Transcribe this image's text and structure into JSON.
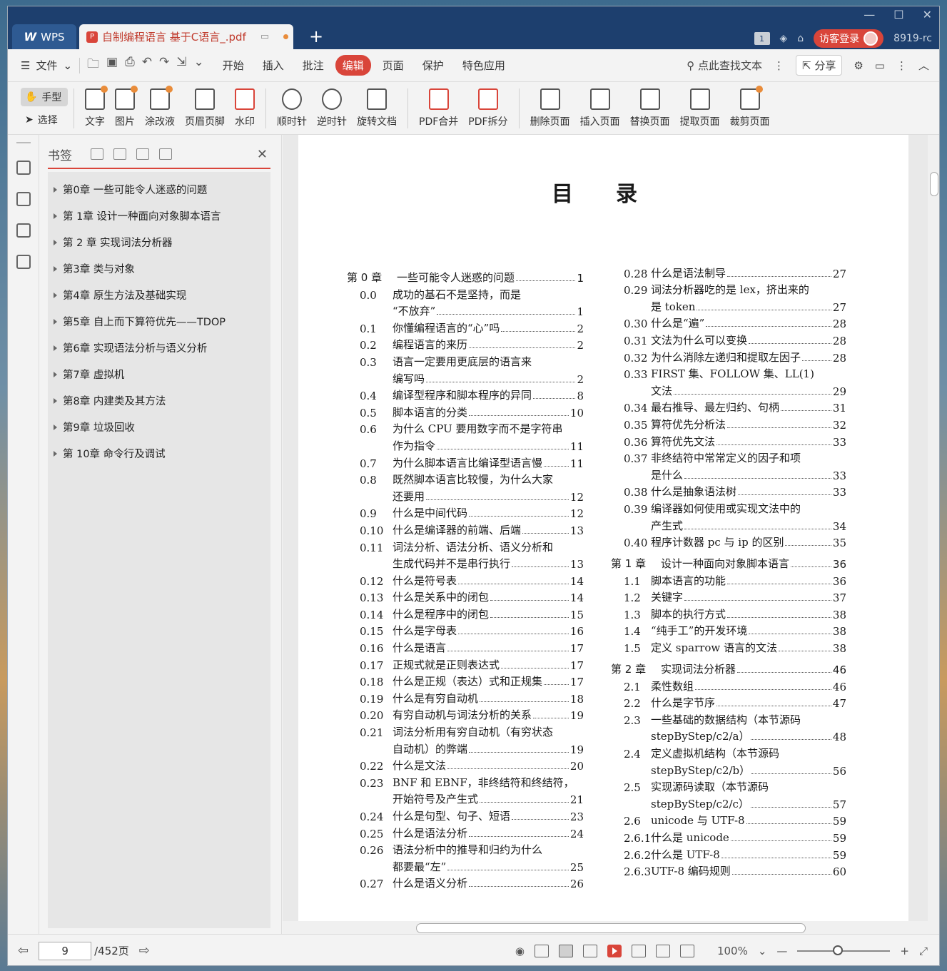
{
  "titlebar": {
    "app_tab": "WPS",
    "doc_tab": "自制编程语言 基于C语言_.pdf",
    "page_badge": "1",
    "login": "访客登录",
    "user_id": "8919-rc"
  },
  "menubar": {
    "file": "文件",
    "items": [
      "开始",
      "插入",
      "批注",
      "编辑",
      "页面",
      "保护",
      "特色应用"
    ],
    "active": "编辑",
    "search": "点此查找文本",
    "share": "分享"
  },
  "ribbon": {
    "hand": "手型",
    "select": "选择",
    "buttons": [
      "文字",
      "图片",
      "涂改液",
      "页眉页脚",
      "水印",
      "顺时针",
      "逆时针",
      "旋转文档",
      "PDF合并",
      "PDF拆分",
      "删除页面",
      "插入页面",
      "替换页面",
      "提取页面",
      "裁剪页面"
    ]
  },
  "bookmarks": {
    "title": "书签",
    "items": [
      "第0章 一些可能令人迷惑的问题",
      "第 1章 设计一种面向对象脚本语言",
      "第 2 章 实现词法分析器",
      "第3章 类与对象",
      "第4章 原生方法及基础实现",
      "第5章 自上而下算符优先——TDOP",
      "第6章 实现语法分析与语义分析",
      "第7章 虚拟机",
      "第8章 内建类及其方法",
      "第9章 垃圾回收",
      "第 10章 命令行及调试"
    ]
  },
  "page": {
    "title": "目录",
    "left": [
      {
        "n": "第 0 章",
        "t": "一些可能令人迷惑的问题",
        "p": "1",
        "ch": true
      },
      {
        "n": "0.0",
        "t": "成功的基石不是坚持，而是",
        "p": ""
      },
      {
        "n": "",
        "t": "“不放弃”",
        "p": "1"
      },
      {
        "n": "0.1",
        "t": "你懂编程语言的“心”吗",
        "p": "2"
      },
      {
        "n": "0.2",
        "t": "编程语言的来历",
        "p": "2"
      },
      {
        "n": "0.3",
        "t": "语言一定要用更底层的语言来",
        "p": ""
      },
      {
        "n": "",
        "t": "编写吗",
        "p": "2"
      },
      {
        "n": "0.4",
        "t": "编译型程序和脚本程序的异同",
        "p": "8"
      },
      {
        "n": "0.5",
        "t": "脚本语言的分类",
        "p": "10"
      },
      {
        "n": "0.6",
        "t": "为什么 CPU 要用数字而不是字符串",
        "p": ""
      },
      {
        "n": "",
        "t": "作为指令",
        "p": "11"
      },
      {
        "n": "0.7",
        "t": "为什么脚本语言比编译型语言慢",
        "p": "11"
      },
      {
        "n": "0.8",
        "t": "既然脚本语言比较慢，为什么大家",
        "p": ""
      },
      {
        "n": "",
        "t": "还要用",
        "p": "12"
      },
      {
        "n": "0.9",
        "t": "什么是中间代码",
        "p": "12"
      },
      {
        "n": "0.10",
        "t": "什么是编译器的前端、后端",
        "p": "13"
      },
      {
        "n": "0.11",
        "t": "词法分析、语法分析、语义分析和",
        "p": ""
      },
      {
        "n": "",
        "t": "生成代码并不是串行执行",
        "p": "13"
      },
      {
        "n": "0.12",
        "t": "什么是符号表",
        "p": "14"
      },
      {
        "n": "0.13",
        "t": "什么是关系中的闭包",
        "p": "14"
      },
      {
        "n": "0.14",
        "t": "什么是程序中的闭包",
        "p": "15"
      },
      {
        "n": "0.15",
        "t": "什么是字母表",
        "p": "16"
      },
      {
        "n": "0.16",
        "t": "什么是语言",
        "p": "17"
      },
      {
        "n": "0.17",
        "t": "正规式就是正则表达式",
        "p": "17"
      },
      {
        "n": "0.18",
        "t": "什么是正规（表达）式和正规集",
        "p": "17"
      },
      {
        "n": "0.19",
        "t": "什么是有穷自动机",
        "p": "18"
      },
      {
        "n": "0.20",
        "t": "有穷自动机与词法分析的关系",
        "p": "19"
      },
      {
        "n": "0.21",
        "t": "词法分析用有穷自动机（有穷状态",
        "p": ""
      },
      {
        "n": "",
        "t": "自动机）的弊端",
        "p": "19"
      },
      {
        "n": "0.22",
        "t": "什么是文法",
        "p": "20"
      },
      {
        "n": "0.23",
        "t": "BNF 和 EBNF，非终结符和终结符，",
        "p": ""
      },
      {
        "n": "",
        "t": "开始符号及产生式",
        "p": "21"
      },
      {
        "n": "0.24",
        "t": "什么是句型、句子、短语",
        "p": "23"
      },
      {
        "n": "0.25",
        "t": "什么是语法分析",
        "p": "24"
      },
      {
        "n": "0.26",
        "t": "语法分析中的推导和归约为什么",
        "p": ""
      },
      {
        "n": "",
        "t": "都要最“左”",
        "p": "25"
      },
      {
        "n": "0.27",
        "t": "什么是语义分析",
        "p": "26"
      }
    ],
    "right": [
      {
        "n": "0.28",
        "t": "什么是语法制导",
        "p": "27"
      },
      {
        "n": "0.29",
        "t": "词法分析器吃的是 lex，挤出来的",
        "p": ""
      },
      {
        "n": "",
        "t": "是 token",
        "p": "27"
      },
      {
        "n": "0.30",
        "t": "什么是“遍”",
        "p": "28"
      },
      {
        "n": "0.31",
        "t": "文法为什么可以变换",
        "p": "28"
      },
      {
        "n": "0.32",
        "t": "为什么消除左递归和提取左因子",
        "p": "28"
      },
      {
        "n": "0.33",
        "t": "FIRST 集、FOLLOW 集、LL(1)",
        "p": ""
      },
      {
        "n": "",
        "t": "文法",
        "p": "29"
      },
      {
        "n": "0.34",
        "t": "最右推导、最左归约、句柄",
        "p": "31"
      },
      {
        "n": "0.35",
        "t": "算符优先分析法",
        "p": "32"
      },
      {
        "n": "0.36",
        "t": "算符优先文法",
        "p": "33"
      },
      {
        "n": "0.37",
        "t": "非终结符中常常定义的因子和项",
        "p": ""
      },
      {
        "n": "",
        "t": "是什么",
        "p": "33"
      },
      {
        "n": "0.38",
        "t": "什么是抽象语法树",
        "p": "33"
      },
      {
        "n": "0.39",
        "t": "编译器如何使用或实现文法中的",
        "p": ""
      },
      {
        "n": "",
        "t": "产生式",
        "p": "34"
      },
      {
        "n": "0.40",
        "t": "程序计数器 pc 与 ip 的区别",
        "p": "35"
      },
      {
        "n": "第 1 章",
        "t": "设计一种面向对象脚本语言",
        "p": "36",
        "ch": true
      },
      {
        "n": "1.1",
        "t": "脚本语言的功能",
        "p": "36"
      },
      {
        "n": "1.2",
        "t": "关键字",
        "p": "37"
      },
      {
        "n": "1.3",
        "t": "脚本的执行方式",
        "p": "38"
      },
      {
        "n": "1.4",
        "t": "“纯手工”的开发环境",
        "p": "38"
      },
      {
        "n": "1.5",
        "t": "定义 sparrow 语言的文法",
        "p": "38"
      },
      {
        "n": "第 2 章",
        "t": "实现词法分析器",
        "p": "46",
        "ch": true
      },
      {
        "n": "2.1",
        "t": "柔性数组",
        "p": "46"
      },
      {
        "n": "2.2",
        "t": "什么是字节序",
        "p": "47"
      },
      {
        "n": "2.3",
        "t": "一些基础的数据结构（本节源码",
        "p": ""
      },
      {
        "n": "",
        "t": "stepByStep/c2/a）",
        "p": "48"
      },
      {
        "n": "2.4",
        "t": "定义虚拟机结构（本节源码",
        "p": ""
      },
      {
        "n": "",
        "t": "stepByStep/c2/b）",
        "p": "56"
      },
      {
        "n": "2.5",
        "t": "实现源码读取（本节源码",
        "p": ""
      },
      {
        "n": "",
        "t": "stepByStep/c2/c）",
        "p": "57"
      },
      {
        "n": "2.6",
        "t": "unicode 与 UTF-8",
        "p": "59"
      },
      {
        "n": "2.6.1",
        "t": "什么是 unicode",
        "p": "59"
      },
      {
        "n": "2.6.2",
        "t": "什么是 UTF-8",
        "p": "59"
      },
      {
        "n": "2.6.3",
        "t": "UTF-8 编码规则",
        "p": "60"
      }
    ]
  },
  "statusbar": {
    "current_page": "9",
    "total_pages": "/452页",
    "zoom": "100%"
  }
}
